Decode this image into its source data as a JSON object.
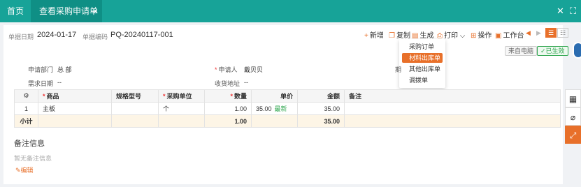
{
  "tabs": {
    "home": "首页",
    "active": "查看采购申请单",
    "close": "×"
  },
  "window_icons": {
    "close": "✕",
    "fullscreen": "⛶"
  },
  "header": {
    "date_label": "单据日期",
    "date_value": "2024-01-17",
    "code_label": "单据编码",
    "code_value": "PQ-20240117-001"
  },
  "toolbar": {
    "add": "新增",
    "copy": "复制",
    "generate": "生成",
    "print": "打印",
    "operate": "操作",
    "workbench": "工作台"
  },
  "badges": {
    "source": "来自电脑",
    "status": "已生效"
  },
  "generate_menu": {
    "items": [
      "采购订单",
      "材料出库单",
      "其他出库单",
      "调拨单"
    ],
    "selected_index": 1
  },
  "form": {
    "dept_label": "申请部门",
    "dept_value": "总 部",
    "applicant_label": "申请人",
    "applicant_value": "戴贝贝",
    "need_date_label": "需求日期",
    "need_date_value": "--",
    "address_label": "收货地址",
    "address_value": "--",
    "cut_label": "期"
  },
  "table": {
    "headers": [
      "",
      "商品",
      "规格型号",
      "采购单位",
      "数量",
      "单价",
      "金额",
      "备注"
    ],
    "required": [
      false,
      true,
      false,
      true,
      true,
      false,
      false,
      false
    ],
    "rows": [
      {
        "idx": "1",
        "product": "主板",
        "spec": "",
        "unit": "个",
        "qty": "1.00",
        "price": "35.00",
        "latest": "最新",
        "amount": "35.00",
        "remark": ""
      }
    ],
    "subtotal": {
      "label": "小计",
      "qty": "1.00",
      "amount": "35.00"
    }
  },
  "notes": {
    "title": "备注信息",
    "empty": "暂无备注信息",
    "edit": "编辑"
  },
  "colors": {
    "teal": "#17a398",
    "accent": "#e8702a",
    "green": "#33a852"
  }
}
